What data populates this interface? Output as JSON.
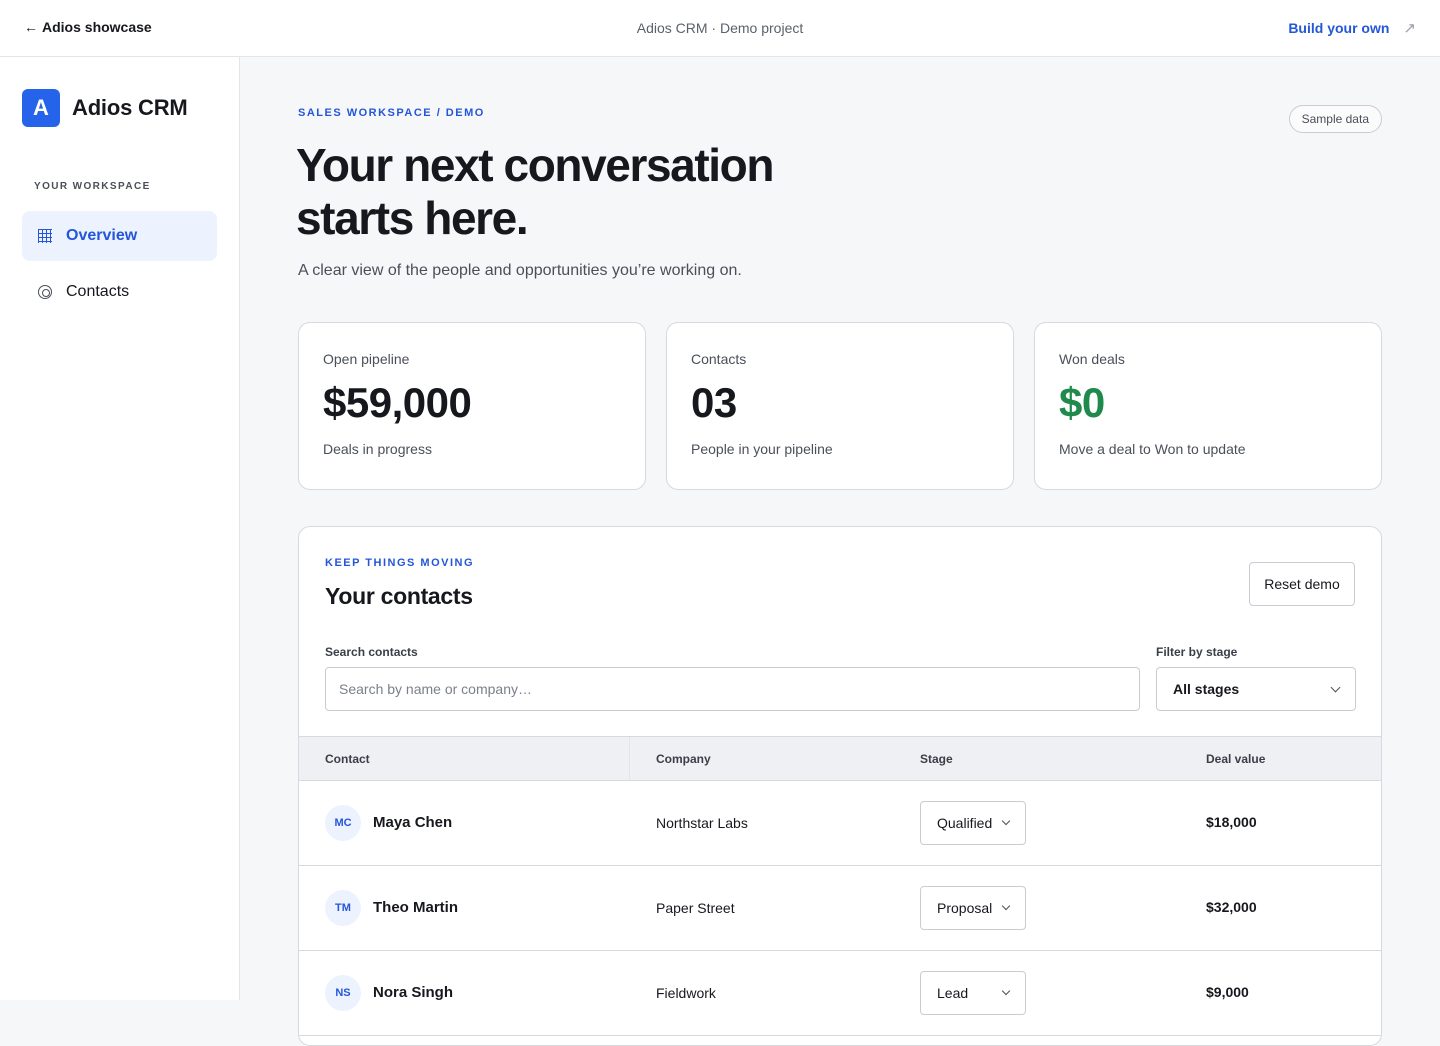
{
  "topbar": {
    "back_label": "Adios showcase",
    "center_text": "Adios CRM · Demo project",
    "build_label": "Build your own"
  },
  "sidebar": {
    "brand_initial": "A",
    "brand_name": "Adios CRM",
    "section_label": "YOUR WORKSPACE",
    "items": [
      {
        "label": "Overview",
        "icon": "grid-icon",
        "active": true
      },
      {
        "label": "Contacts",
        "icon": "circle-icon",
        "active": false
      }
    ]
  },
  "hero": {
    "eyebrow": "SALES WORKSPACE / DEMO",
    "badge": "Sample data",
    "title": "Your next conversation starts here.",
    "subtitle": "A clear view of the people and opportunities you’re working on."
  },
  "stats": [
    {
      "label": "Open pipeline",
      "value": "$59,000",
      "sub": "Deals in progress"
    },
    {
      "label": "Contacts",
      "value": "03",
      "sub": "People in your pipeline"
    },
    {
      "label": "Won deals",
      "value": "$0",
      "sub": "Move a deal to Won to update",
      "color": "#1f8a4c"
    }
  ],
  "contacts_panel": {
    "eyebrow": "KEEP THINGS MOVING",
    "title": "Your contacts",
    "reset_label": "Reset demo",
    "search_label": "Search contacts",
    "search_placeholder": "Search by name or company…",
    "filter_label": "Filter by stage",
    "filter_value": "All stages",
    "columns": [
      "Contact",
      "Company",
      "Stage",
      "Deal value"
    ],
    "rows": [
      {
        "initials": "MC",
        "name": "Maya Chen",
        "company": "Northstar Labs",
        "stage": "Qualified",
        "value": "$18,000"
      },
      {
        "initials": "TM",
        "name": "Theo Martin",
        "company": "Paper Street",
        "stage": "Proposal",
        "value": "$32,000"
      },
      {
        "initials": "NS",
        "name": "Nora Singh",
        "company": "Fieldwork",
        "stage": "Lead",
        "value": "$9,000"
      }
    ]
  },
  "colors": {
    "accent": "#2456d8",
    "success": "#1f8a4c",
    "brand": "#2563eb"
  }
}
